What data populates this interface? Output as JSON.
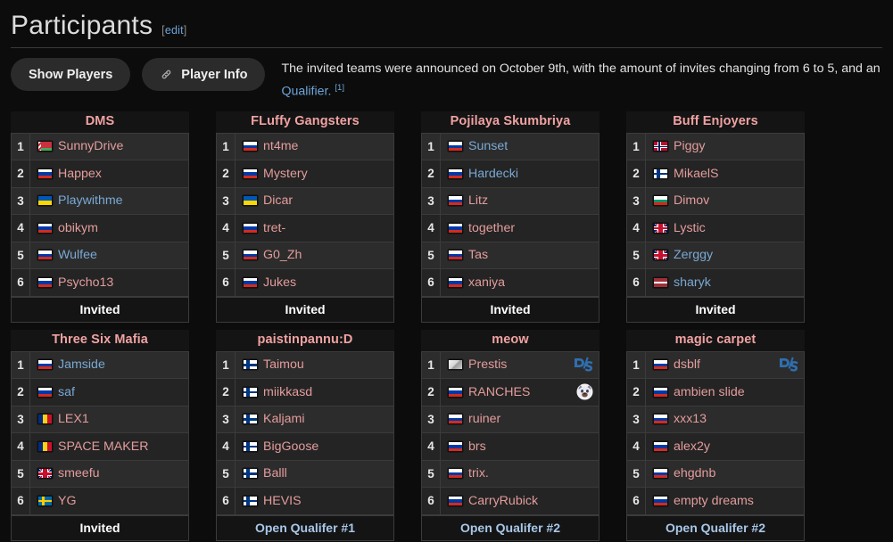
{
  "header": {
    "title": "Participants",
    "edit_open": "[",
    "edit_label": "edit",
    "edit_close": "]"
  },
  "toolbar": {
    "show_players_label": "Show Players",
    "player_info_label": "Player Info",
    "player_info_icon": "link-icon",
    "description_line1": "The invited teams were announced on October 9th, with the amount of invites changing from 6 to 5, and an",
    "description_link": "Qualifier.",
    "description_ref": "[1]"
  },
  "colors": {
    "page_background": "#0c0c0c",
    "card_header_background": "#141414",
    "team_name": "#f0a2a2",
    "row_odd": "#2c2c2c",
    "row_even": "#242424",
    "border": "#3b3b3b",
    "link_red": "#e49c9c",
    "link_blue": "#79a9d4",
    "footer_link": "#a8c7e8",
    "edit_link": "#6da5d8"
  },
  "teams": [
    {
      "name": "DMS",
      "qualification": "Invited",
      "qualification_is_link": false,
      "players": [
        {
          "num": "1",
          "name": "SunnyDrive",
          "flag": "by",
          "color": "red",
          "badge": ""
        },
        {
          "num": "2",
          "name": "Happex",
          "flag": "ru",
          "color": "red",
          "badge": ""
        },
        {
          "num": "3",
          "name": "Playwithme",
          "flag": "ua",
          "color": "blue",
          "badge": ""
        },
        {
          "num": "4",
          "name": "obikym",
          "flag": "ru",
          "color": "red",
          "badge": ""
        },
        {
          "num": "5",
          "name": "Wulfee",
          "flag": "ru",
          "color": "blue",
          "badge": ""
        },
        {
          "num": "6",
          "name": "Psycho13",
          "flag": "ru",
          "color": "red",
          "badge": ""
        }
      ]
    },
    {
      "name": "FLuffy Gangsters",
      "qualification": "Invited",
      "qualification_is_link": false,
      "players": [
        {
          "num": "1",
          "name": "nt4me",
          "flag": "ru",
          "color": "red",
          "badge": ""
        },
        {
          "num": "2",
          "name": "Mystery",
          "flag": "ru",
          "color": "red",
          "badge": ""
        },
        {
          "num": "3",
          "name": "Dicar",
          "flag": "ua",
          "color": "red",
          "badge": ""
        },
        {
          "num": "4",
          "name": "tret-",
          "flag": "ru",
          "color": "red",
          "badge": ""
        },
        {
          "num": "5",
          "name": "G0_Zh",
          "flag": "ru",
          "color": "red",
          "badge": ""
        },
        {
          "num": "6",
          "name": "Jukes",
          "flag": "ru",
          "color": "red",
          "badge": ""
        }
      ]
    },
    {
      "name": "Pojilaya Skumbriya",
      "qualification": "Invited",
      "qualification_is_link": false,
      "players": [
        {
          "num": "1",
          "name": "Sunset",
          "flag": "ru",
          "color": "blue",
          "badge": ""
        },
        {
          "num": "2",
          "name": "Hardecki",
          "flag": "ru",
          "color": "blue",
          "badge": ""
        },
        {
          "num": "3",
          "name": "Litz",
          "flag": "ru",
          "color": "red",
          "badge": ""
        },
        {
          "num": "4",
          "name": "together",
          "flag": "ru",
          "color": "red",
          "badge": ""
        },
        {
          "num": "5",
          "name": "Tas",
          "flag": "ru",
          "color": "red",
          "badge": ""
        },
        {
          "num": "6",
          "name": "xaniya",
          "flag": "ru",
          "color": "red",
          "badge": ""
        }
      ]
    },
    {
      "name": "Buff Enjoyers",
      "qualification": "Invited",
      "qualification_is_link": false,
      "players": [
        {
          "num": "1",
          "name": "Piggy",
          "flag": "no",
          "color": "red",
          "badge": ""
        },
        {
          "num": "2",
          "name": "MikaelS",
          "flag": "fi",
          "color": "red",
          "badge": ""
        },
        {
          "num": "3",
          "name": "Dimov",
          "flag": "bg",
          "color": "red",
          "badge": ""
        },
        {
          "num": "4",
          "name": "Lystic",
          "flag": "gb",
          "color": "red",
          "badge": ""
        },
        {
          "num": "5",
          "name": "Zerggy",
          "flag": "gb",
          "color": "blue",
          "badge": ""
        },
        {
          "num": "6",
          "name": "sharyk",
          "flag": "lv",
          "color": "blue",
          "badge": ""
        }
      ]
    },
    {
      "name": "Three Six Mafia",
      "qualification": "Invited",
      "qualification_is_link": false,
      "players": [
        {
          "num": "1",
          "name": "Jamside",
          "flag": "ru",
          "color": "blue",
          "badge": ""
        },
        {
          "num": "2",
          "name": "saf",
          "flag": "ru",
          "color": "blue",
          "badge": ""
        },
        {
          "num": "3",
          "name": "LEX1",
          "flag": "ro",
          "color": "red",
          "badge": ""
        },
        {
          "num": "4",
          "name": "SPACE MAKER",
          "flag": "ro",
          "color": "red",
          "badge": ""
        },
        {
          "num": "5",
          "name": "smeefu",
          "flag": "gb",
          "color": "red",
          "badge": ""
        },
        {
          "num": "6",
          "name": "YG",
          "flag": "se",
          "color": "red",
          "badge": ""
        }
      ]
    },
    {
      "name": "paistinpannu:D",
      "qualification": "Open Qualifer #1",
      "qualification_is_link": true,
      "players": [
        {
          "num": "1",
          "name": "Taimou",
          "flag": "fi",
          "color": "red",
          "badge": ""
        },
        {
          "num": "2",
          "name": "miikkasd",
          "flag": "fi",
          "color": "red",
          "badge": ""
        },
        {
          "num": "3",
          "name": "Kaljami",
          "flag": "fi",
          "color": "red",
          "badge": ""
        },
        {
          "num": "4",
          "name": "BigGoose",
          "flag": "fi",
          "color": "red",
          "badge": ""
        },
        {
          "num": "5",
          "name": "Balll",
          "flag": "fi",
          "color": "red",
          "badge": ""
        },
        {
          "num": "6",
          "name": "HEVIS",
          "flag": "fi",
          "color": "red",
          "badge": ""
        }
      ]
    },
    {
      "name": "meow",
      "qualification": "Open Qualifer #2",
      "qualification_is_link": true,
      "players": [
        {
          "num": "1",
          "name": "Prestis",
          "flag": "xx",
          "color": "red",
          "badge": "team-logo-icon"
        },
        {
          "num": "2",
          "name": "RANCHES",
          "flag": "ru",
          "color": "red",
          "badge": "avatar-icon"
        },
        {
          "num": "3",
          "name": "ruiner",
          "flag": "ru",
          "color": "red",
          "badge": ""
        },
        {
          "num": "4",
          "name": "brs",
          "flag": "ru",
          "color": "red",
          "badge": ""
        },
        {
          "num": "5",
          "name": "trix.",
          "flag": "ru",
          "color": "red",
          "badge": ""
        },
        {
          "num": "6",
          "name": "CarryRubick",
          "flag": "ru",
          "color": "red",
          "badge": ""
        }
      ]
    },
    {
      "name": "magic carpet",
      "qualification": "Open Qualifer #2",
      "qualification_is_link": true,
      "players": [
        {
          "num": "1",
          "name": "dsblf",
          "flag": "ru",
          "color": "red",
          "badge": "team-logo-icon"
        },
        {
          "num": "2",
          "name": "ambien slide",
          "flag": "ru",
          "color": "red",
          "badge": ""
        },
        {
          "num": "3",
          "name": "xxx13",
          "flag": "ru",
          "color": "red",
          "badge": ""
        },
        {
          "num": "4",
          "name": "alex2y",
          "flag": "ru",
          "color": "red",
          "badge": ""
        },
        {
          "num": "5",
          "name": "ehgdnb",
          "flag": "ru",
          "color": "red",
          "badge": ""
        },
        {
          "num": "6",
          "name": "empty dreams",
          "flag": "ru",
          "color": "red",
          "badge": ""
        }
      ]
    }
  ]
}
